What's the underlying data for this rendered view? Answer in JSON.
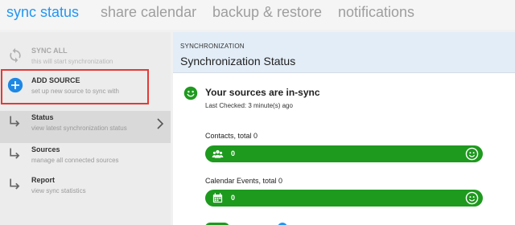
{
  "tabs": [
    {
      "label": "sync status",
      "active": true
    },
    {
      "label": "share calendar",
      "active": false
    },
    {
      "label": "backup & restore",
      "active": false
    },
    {
      "label": "notifications",
      "active": false
    }
  ],
  "sidebar": {
    "items": [
      {
        "title": "SYNC ALL",
        "subtitle": "this will start synchronization",
        "icon": "sync-icon",
        "state": "disabled"
      },
      {
        "title": "ADD SOURCE",
        "subtitle": "set up new source to sync with",
        "icon": "add-circle-icon",
        "state": "highlighted"
      },
      {
        "title": "Status",
        "subtitle": "view latest synchronization status",
        "icon": "arrow-return-right-icon",
        "state": "selected"
      },
      {
        "title": "Sources",
        "subtitle": "manage all connected sources",
        "icon": "arrow-return-right-icon",
        "state": "normal"
      },
      {
        "title": "Report",
        "subtitle": "view sync statistics",
        "icon": "arrow-return-right-icon",
        "state": "normal"
      }
    ]
  },
  "main": {
    "kicker": "SYNCHRONIZATION",
    "title": "Synchronization Status",
    "status_heading": "Your sources are in-sync",
    "last_checked": "Last Checked: 3 minute(s) ago",
    "sections": [
      {
        "label": "Contacts, total 0",
        "value": "0",
        "icon": "contacts-group-icon"
      },
      {
        "label": "Calendar Events, total 0",
        "value": "0",
        "icon": "calendar-icon"
      }
    ]
  },
  "colors": {
    "accent": "#2196f3",
    "success": "#1e9a1e",
    "highlight_border": "#e53935",
    "header_bg": "#e3edf7"
  }
}
